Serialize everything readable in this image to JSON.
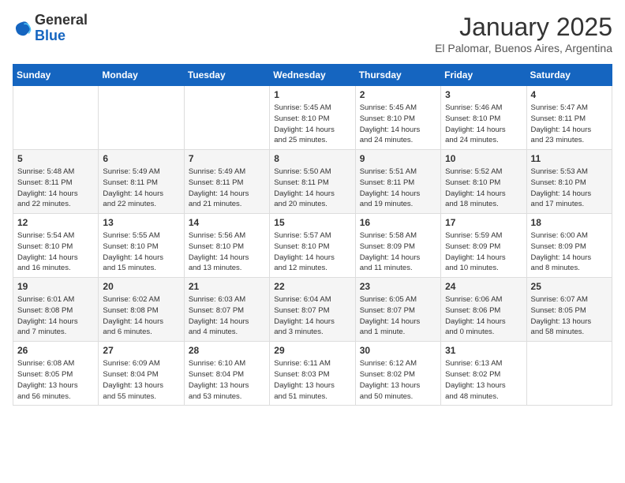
{
  "header": {
    "logo_general": "General",
    "logo_blue": "Blue",
    "month": "January 2025",
    "location": "El Palomar, Buenos Aires, Argentina"
  },
  "weekdays": [
    "Sunday",
    "Monday",
    "Tuesday",
    "Wednesday",
    "Thursday",
    "Friday",
    "Saturday"
  ],
  "weeks": [
    [
      {
        "day": "",
        "info": ""
      },
      {
        "day": "",
        "info": ""
      },
      {
        "day": "",
        "info": ""
      },
      {
        "day": "1",
        "info": "Sunrise: 5:45 AM\nSunset: 8:10 PM\nDaylight: 14 hours\nand 25 minutes."
      },
      {
        "day": "2",
        "info": "Sunrise: 5:45 AM\nSunset: 8:10 PM\nDaylight: 14 hours\nand 24 minutes."
      },
      {
        "day": "3",
        "info": "Sunrise: 5:46 AM\nSunset: 8:10 PM\nDaylight: 14 hours\nand 24 minutes."
      },
      {
        "day": "4",
        "info": "Sunrise: 5:47 AM\nSunset: 8:11 PM\nDaylight: 14 hours\nand 23 minutes."
      }
    ],
    [
      {
        "day": "5",
        "info": "Sunrise: 5:48 AM\nSunset: 8:11 PM\nDaylight: 14 hours\nand 22 minutes."
      },
      {
        "day": "6",
        "info": "Sunrise: 5:49 AM\nSunset: 8:11 PM\nDaylight: 14 hours\nand 22 minutes."
      },
      {
        "day": "7",
        "info": "Sunrise: 5:49 AM\nSunset: 8:11 PM\nDaylight: 14 hours\nand 21 minutes."
      },
      {
        "day": "8",
        "info": "Sunrise: 5:50 AM\nSunset: 8:11 PM\nDaylight: 14 hours\nand 20 minutes."
      },
      {
        "day": "9",
        "info": "Sunrise: 5:51 AM\nSunset: 8:11 PM\nDaylight: 14 hours\nand 19 minutes."
      },
      {
        "day": "10",
        "info": "Sunrise: 5:52 AM\nSunset: 8:10 PM\nDaylight: 14 hours\nand 18 minutes."
      },
      {
        "day": "11",
        "info": "Sunrise: 5:53 AM\nSunset: 8:10 PM\nDaylight: 14 hours\nand 17 minutes."
      }
    ],
    [
      {
        "day": "12",
        "info": "Sunrise: 5:54 AM\nSunset: 8:10 PM\nDaylight: 14 hours\nand 16 minutes."
      },
      {
        "day": "13",
        "info": "Sunrise: 5:55 AM\nSunset: 8:10 PM\nDaylight: 14 hours\nand 15 minutes."
      },
      {
        "day": "14",
        "info": "Sunrise: 5:56 AM\nSunset: 8:10 PM\nDaylight: 14 hours\nand 13 minutes."
      },
      {
        "day": "15",
        "info": "Sunrise: 5:57 AM\nSunset: 8:10 PM\nDaylight: 14 hours\nand 12 minutes."
      },
      {
        "day": "16",
        "info": "Sunrise: 5:58 AM\nSunset: 8:09 PM\nDaylight: 14 hours\nand 11 minutes."
      },
      {
        "day": "17",
        "info": "Sunrise: 5:59 AM\nSunset: 8:09 PM\nDaylight: 14 hours\nand 10 minutes."
      },
      {
        "day": "18",
        "info": "Sunrise: 6:00 AM\nSunset: 8:09 PM\nDaylight: 14 hours\nand 8 minutes."
      }
    ],
    [
      {
        "day": "19",
        "info": "Sunrise: 6:01 AM\nSunset: 8:08 PM\nDaylight: 14 hours\nand 7 minutes."
      },
      {
        "day": "20",
        "info": "Sunrise: 6:02 AM\nSunset: 8:08 PM\nDaylight: 14 hours\nand 6 minutes."
      },
      {
        "day": "21",
        "info": "Sunrise: 6:03 AM\nSunset: 8:07 PM\nDaylight: 14 hours\nand 4 minutes."
      },
      {
        "day": "22",
        "info": "Sunrise: 6:04 AM\nSunset: 8:07 PM\nDaylight: 14 hours\nand 3 minutes."
      },
      {
        "day": "23",
        "info": "Sunrise: 6:05 AM\nSunset: 8:07 PM\nDaylight: 14 hours\nand 1 minute."
      },
      {
        "day": "24",
        "info": "Sunrise: 6:06 AM\nSunset: 8:06 PM\nDaylight: 14 hours\nand 0 minutes."
      },
      {
        "day": "25",
        "info": "Sunrise: 6:07 AM\nSunset: 8:05 PM\nDaylight: 13 hours\nand 58 minutes."
      }
    ],
    [
      {
        "day": "26",
        "info": "Sunrise: 6:08 AM\nSunset: 8:05 PM\nDaylight: 13 hours\nand 56 minutes."
      },
      {
        "day": "27",
        "info": "Sunrise: 6:09 AM\nSunset: 8:04 PM\nDaylight: 13 hours\nand 55 minutes."
      },
      {
        "day": "28",
        "info": "Sunrise: 6:10 AM\nSunset: 8:04 PM\nDaylight: 13 hours\nand 53 minutes."
      },
      {
        "day": "29",
        "info": "Sunrise: 6:11 AM\nSunset: 8:03 PM\nDaylight: 13 hours\nand 51 minutes."
      },
      {
        "day": "30",
        "info": "Sunrise: 6:12 AM\nSunset: 8:02 PM\nDaylight: 13 hours\nand 50 minutes."
      },
      {
        "day": "31",
        "info": "Sunrise: 6:13 AM\nSunset: 8:02 PM\nDaylight: 13 hours\nand 48 minutes."
      },
      {
        "day": "",
        "info": ""
      }
    ]
  ]
}
